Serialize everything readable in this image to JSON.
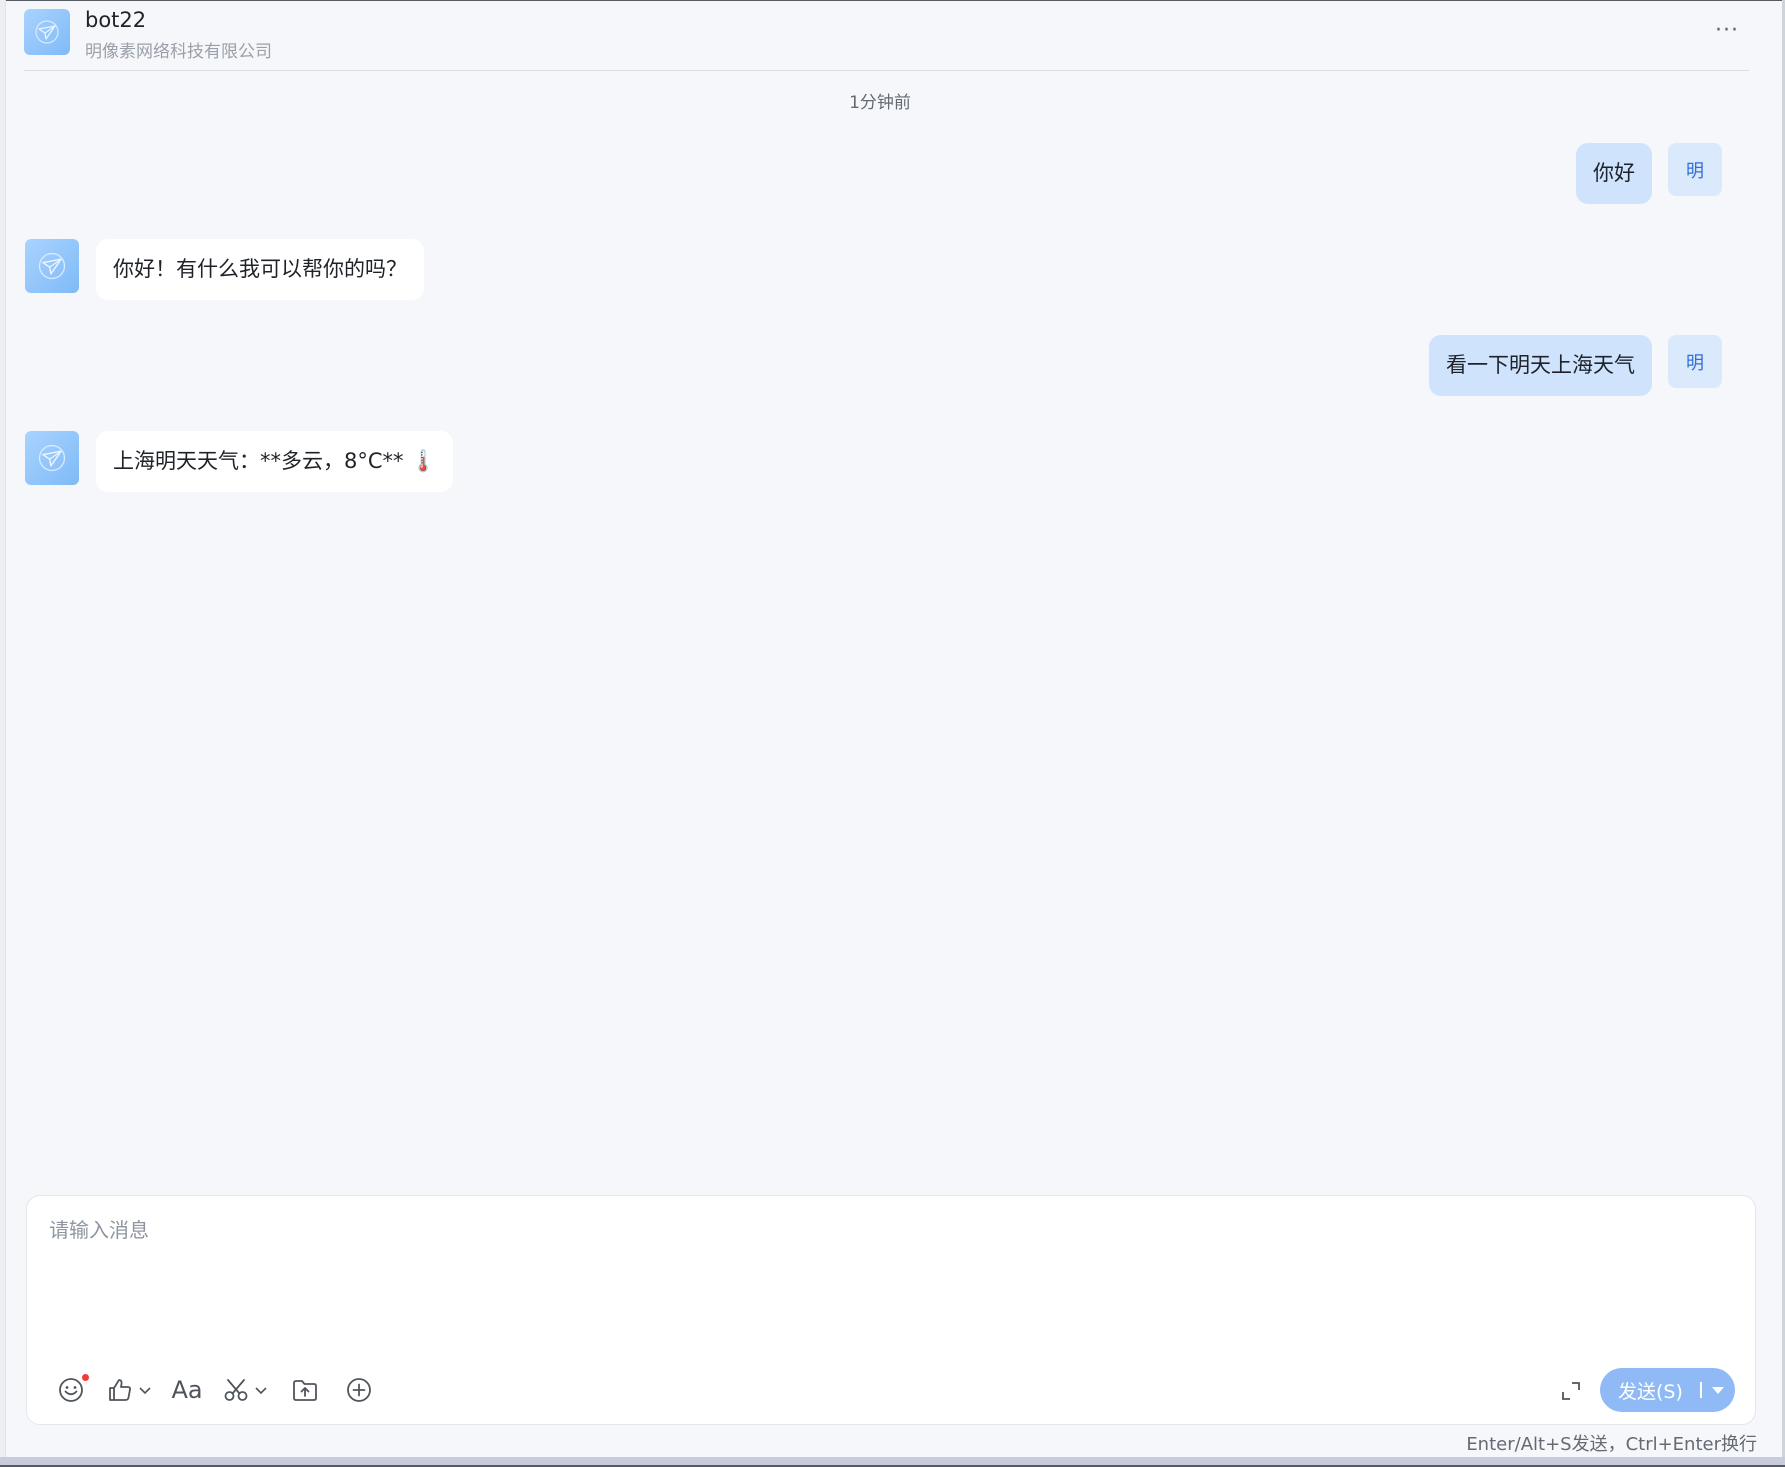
{
  "header": {
    "bot_name": "bot22",
    "company": "明像素网络科技有限公司",
    "more_label": "···",
    "avatar_icon": "paper-plane-logo-icon"
  },
  "timestamp": "1分钟前",
  "messages": [
    {
      "role": "user",
      "text": "你好",
      "avatar_label": "明"
    },
    {
      "role": "bot",
      "text": "你好！有什么我可以帮你的吗？"
    },
    {
      "role": "user",
      "text": "看一下明天上海天气",
      "avatar_label": "明"
    },
    {
      "role": "bot",
      "text": "上海明天天气：**多云，8°C** 🌡️"
    }
  ],
  "composer": {
    "placeholder": "请输入消息",
    "value": "",
    "send_label": "发送(S)",
    "hint": "Enter/Alt+S发送，Ctrl+Enter换行",
    "font_label": "Aa",
    "tools": [
      "emoji-icon",
      "thumbs-up-icon",
      "font-icon",
      "scissors-icon",
      "upload-folder-icon",
      "plus-circle-icon"
    ]
  },
  "colors": {
    "accent": "#8fbaf6",
    "user_bubble": "#cfe3fd",
    "background": "#f6f7fb",
    "notification_dot": "#f23b3b"
  }
}
